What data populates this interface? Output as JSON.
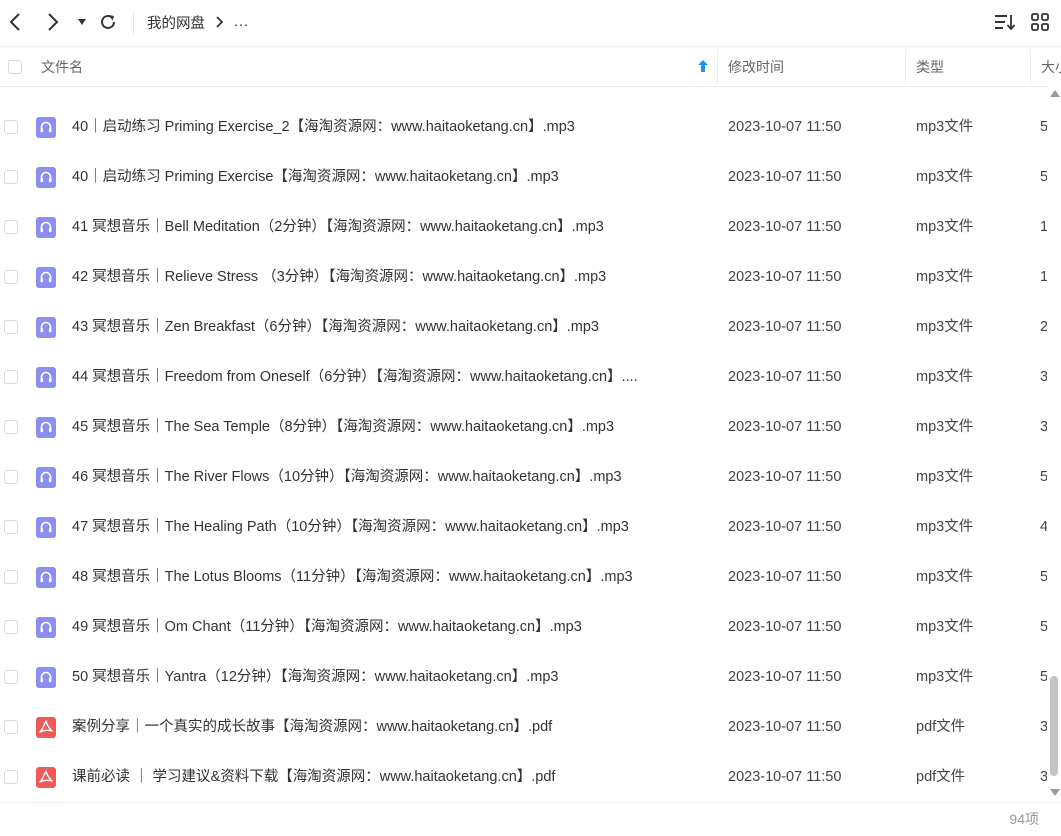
{
  "toolbar": {
    "back_icon": "chevron-left-icon",
    "forward_icon": "chevron-right-icon",
    "history_icon": "caret-down-icon",
    "refresh_icon": "refresh-icon",
    "breadcrumb_root": "我的网盘",
    "breadcrumb_sep_icon": "chevron-right-icon",
    "breadcrumb_more": "...",
    "sort_icon": "sort-list-icon",
    "view_icon": "grid-view-icon"
  },
  "columns": {
    "name": "文件名",
    "modified": "修改时间",
    "type": "类型",
    "size": "大小"
  },
  "files": [
    {
      "name": "40｜启动练习 Priming Exercise_2【海淘资源网：www.haitaoketang.cn】.mp3",
      "modified": "2023-10-07 11:50",
      "type": "mp3文件",
      "size": "5",
      "icon": "audio-file-icon"
    },
    {
      "name": "40｜启动练习 Priming Exercise【海淘资源网：www.haitaoketang.cn】.mp3",
      "modified": "2023-10-07 11:50",
      "type": "mp3文件",
      "size": "5",
      "icon": "audio-file-icon"
    },
    {
      "name": "41 冥想音乐｜Bell Meditation（2分钟）【海淘资源网：www.haitaoketang.cn】.mp3",
      "modified": "2023-10-07 11:50",
      "type": "mp3文件",
      "size": "1",
      "icon": "audio-file-icon"
    },
    {
      "name": "42 冥想音乐｜Relieve Stress （3分钟）【海淘资源网：www.haitaoketang.cn】.mp3",
      "modified": "2023-10-07 11:50",
      "type": "mp3文件",
      "size": "1",
      "icon": "audio-file-icon"
    },
    {
      "name": "43 冥想音乐｜Zen Breakfast（6分钟）【海淘资源网：www.haitaoketang.cn】.mp3",
      "modified": "2023-10-07 11:50",
      "type": "mp3文件",
      "size": "2",
      "icon": "audio-file-icon"
    },
    {
      "name": "44 冥想音乐｜Freedom from Oneself（6分钟）【海淘资源网：www.haitaoketang.cn】....",
      "modified": "2023-10-07 11:50",
      "type": "mp3文件",
      "size": "3",
      "icon": "audio-file-icon"
    },
    {
      "name": "45 冥想音乐｜The Sea Temple（8分钟）【海淘资源网：www.haitaoketang.cn】.mp3",
      "modified": "2023-10-07 11:50",
      "type": "mp3文件",
      "size": "3",
      "icon": "audio-file-icon"
    },
    {
      "name": "46 冥想音乐｜The River Flows（10分钟）【海淘资源网：www.haitaoketang.cn】.mp3",
      "modified": "2023-10-07 11:50",
      "type": "mp3文件",
      "size": "5",
      "icon": "audio-file-icon"
    },
    {
      "name": "47 冥想音乐｜The Healing Path（10分钟）【海淘资源网：www.haitaoketang.cn】.mp3",
      "modified": "2023-10-07 11:50",
      "type": "mp3文件",
      "size": "4",
      "icon": "audio-file-icon"
    },
    {
      "name": "48 冥想音乐｜The Lotus Blooms（11分钟）【海淘资源网：www.haitaoketang.cn】.mp3",
      "modified": "2023-10-07 11:50",
      "type": "mp3文件",
      "size": "5",
      "icon": "audio-file-icon"
    },
    {
      "name": "49 冥想音乐｜Om Chant（11分钟）【海淘资源网：www.haitaoketang.cn】.mp3",
      "modified": "2023-10-07 11:50",
      "type": "mp3文件",
      "size": "5",
      "icon": "audio-file-icon"
    },
    {
      "name": "50 冥想音乐｜Yantra（12分钟）【海淘资源网：www.haitaoketang.cn】.mp3",
      "modified": "2023-10-07 11:50",
      "type": "mp3文件",
      "size": "5",
      "icon": "audio-file-icon"
    },
    {
      "name": "案例分享｜一个真实的成长故事【海淘资源网：www.haitaoketang.cn】.pdf",
      "modified": "2023-10-07 11:50",
      "type": "pdf文件",
      "size": "3",
      "icon": "pdf-file-icon"
    },
    {
      "name": "课前必读 ｜ 学习建议&资料下载【海淘资源网：www.haitaoketang.cn】.pdf",
      "modified": "2023-10-07 11:50",
      "type": "pdf文件",
      "size": "3",
      "icon": "pdf-file-icon"
    }
  ],
  "footer": {
    "item_count": "94项"
  },
  "colors": {
    "audio_icon": "#8a8ff0",
    "pdf_icon": "#f05a5a",
    "sort_arrow": "#1e90ff",
    "divider": "#ececec"
  }
}
